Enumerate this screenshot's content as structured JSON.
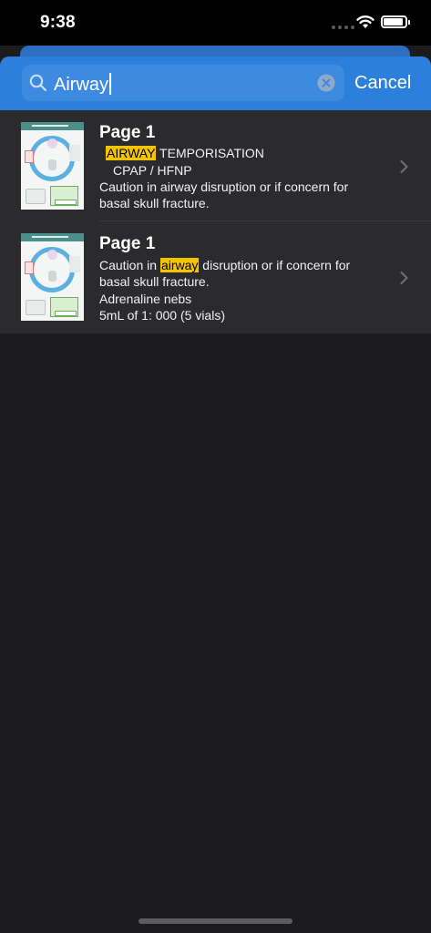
{
  "status_bar": {
    "time": "9:38"
  },
  "search": {
    "query": "Airway",
    "cancel_label": "Cancel"
  },
  "results": [
    {
      "title": "Page 1",
      "lines": [
        {
          "highlight": "AIRWAY",
          "rest": " TEMPORISATION"
        },
        {
          "text": "CPAP / HFNP"
        },
        {
          "text": "Caution in airway disruption or if concern for"
        },
        {
          "text": "basal skull fracture."
        }
      ]
    },
    {
      "title": "Page 1",
      "lines": [
        {
          "pre": "Caution in ",
          "highlight": "airway",
          "rest": " disruption or if concern for"
        },
        {
          "text": "basal skull fracture."
        },
        {
          "text": "Adrenaline nebs"
        },
        {
          "text": "5mL of 1: 000 (5 vials)"
        }
      ]
    }
  ],
  "colors": {
    "search_header": "#2d7fdc",
    "highlight": "#f5c400",
    "row_background": "#2b2b2d",
    "background": "#1c1c1e"
  },
  "icons": {
    "search": "search-icon",
    "clear": "clear-icon",
    "chevron": "chevron-right-icon",
    "wifi": "wifi-icon",
    "battery": "battery-icon"
  }
}
